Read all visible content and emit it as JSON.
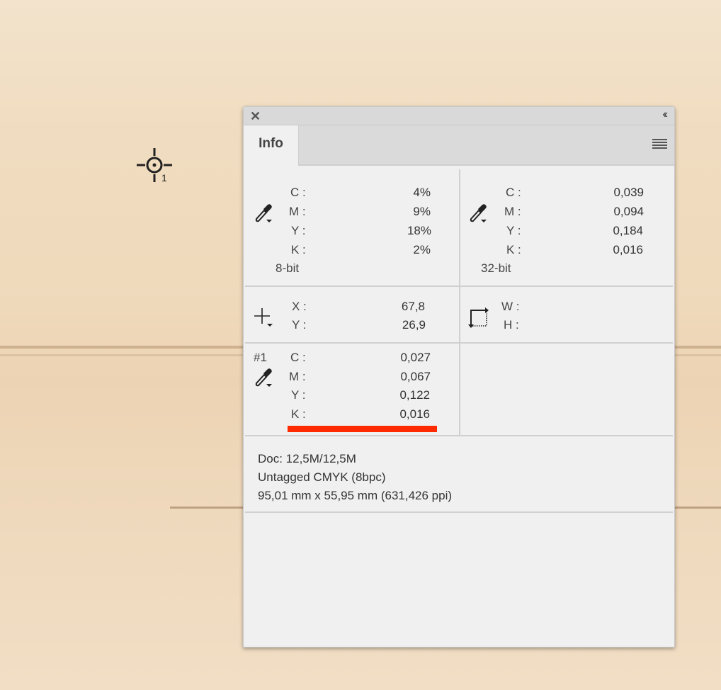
{
  "sampler": {
    "number": "1"
  },
  "panel": {
    "tab_label": "Info",
    "color_left": {
      "labels": [
        "C :",
        "M :",
        "Y :",
        "K :"
      ],
      "values": [
        "4%",
        "9%",
        "18%",
        "2%"
      ],
      "mode": "8-bit"
    },
    "color_right": {
      "labels": [
        "C :",
        "M :",
        "Y :",
        "K :"
      ],
      "values": [
        "0,039",
        "0,094",
        "0,184",
        "0,016"
      ],
      "mode": "32-bit"
    },
    "position": {
      "labels": [
        "X :",
        "Y :"
      ],
      "values": [
        "67,8",
        "26,9"
      ]
    },
    "size": {
      "labels": [
        "W :",
        "H :"
      ]
    },
    "sampler1": {
      "id": "#1",
      "labels": [
        "C :",
        "M :",
        "Y :",
        "K :"
      ],
      "values": [
        "0,027",
        "0,067",
        "0,122",
        "0,016"
      ]
    },
    "doc": {
      "line1": "Doc: 12,5M/12,5M",
      "line2": "Untagged CMYK (8bpc)",
      "line3": "95,01 mm x 55,95 mm (631,426 ppi)"
    },
    "highlight_color": "#ff2a00"
  }
}
